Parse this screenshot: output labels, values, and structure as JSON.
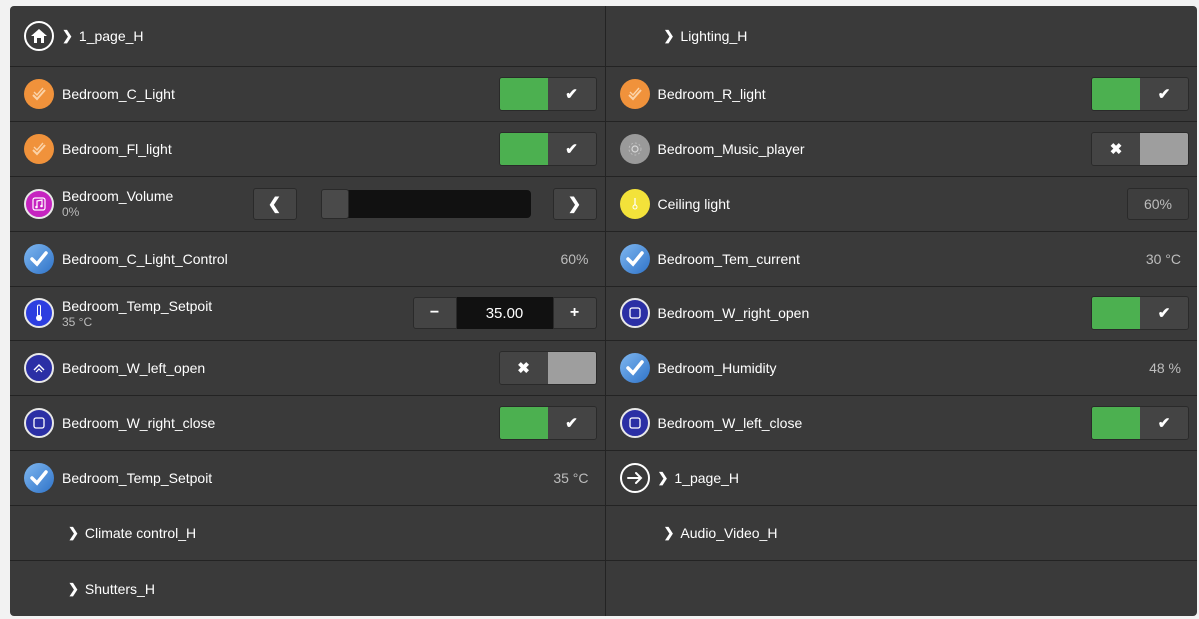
{
  "left": {
    "r1": {
      "label": "1_page_H"
    },
    "r2": {
      "label": "Bedroom_C_Light",
      "state": "on"
    },
    "r3": {
      "label": "Bedroom_Fl_light",
      "state": "on"
    },
    "r4": {
      "label": "Bedroom_Volume",
      "sub": "0%",
      "level": 0
    },
    "r5": {
      "label": "Bedroom_C_Light_Control",
      "value": "60%"
    },
    "r6": {
      "label": "Bedroom_Temp_Setpoit",
      "sub": "35 °C",
      "value": "35.00"
    },
    "r7": {
      "label": "Bedroom_W_left_open",
      "state": "off"
    },
    "r8": {
      "label": "Bedroom_W_right_close",
      "state": "on"
    },
    "r9": {
      "label": "Bedroom_Temp_Setpoit",
      "value": "35 °C"
    },
    "r10": {
      "label": "Climate control_H"
    },
    "r11": {
      "label": "Shutters_H"
    }
  },
  "right": {
    "r1": {
      "label": "Lighting_H"
    },
    "r2": {
      "label": "Bedroom_R_light",
      "state": "on"
    },
    "r3": {
      "label": "Bedroom_Music_player",
      "state": "off"
    },
    "r4": {
      "label": "Ceiling light",
      "value": "60%"
    },
    "r5": {
      "label": "Bedroom_Tem_current",
      "value": "30 °C"
    },
    "r6": {
      "label": "Bedroom_W_right_open",
      "state": "on"
    },
    "r7": {
      "label": "Bedroom_Humidity",
      "value": "48 %"
    },
    "r8": {
      "label": "Bedroom_W_left_close",
      "state": "on"
    },
    "r9": {
      "label": "1_page_H"
    },
    "r10": {
      "label": "Audio_Video_H"
    }
  },
  "glyphs": {
    "chevron": "❯",
    "check": "✔",
    "cross": "✖",
    "left": "❮",
    "right": "❯",
    "minus": "−",
    "plus": "+"
  },
  "colors": {
    "on": "#4cb050",
    "off": "#9e9e9e",
    "background": "#3a3a3a"
  }
}
